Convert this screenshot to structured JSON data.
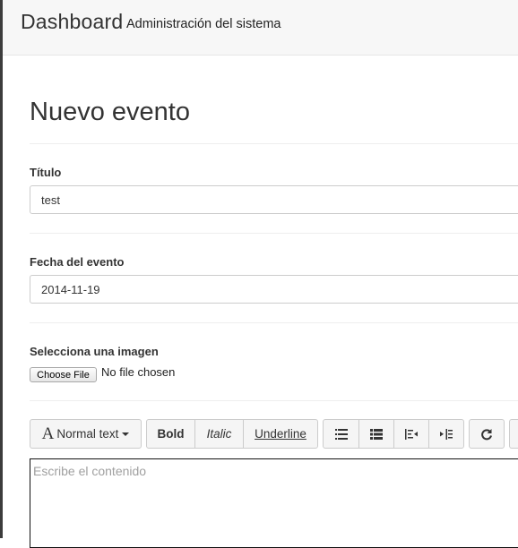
{
  "header": {
    "brand": "Dashboard",
    "subtitle": "Administración del sistema"
  },
  "page": {
    "title": "Nuevo evento"
  },
  "form": {
    "titulo": {
      "label": "Título",
      "value": "test"
    },
    "fecha": {
      "label": "Fecha del evento",
      "value": "2014-11-19"
    },
    "imagen": {
      "label": "Selecciona una imagen",
      "button_label": "Choose File",
      "status": "No file chosen"
    },
    "editor": {
      "placeholder": "Escribe el contenido"
    }
  },
  "toolbar": {
    "style_icon": "A",
    "style_label": "Normal text",
    "bold_label": "Bold",
    "italic_label": "Italic",
    "underline_label": "Underline",
    "icons": [
      "unordered-list-icon",
      "ordered-list-icon",
      "outdent-icon",
      "indent-icon",
      "redo-icon"
    ]
  },
  "colors": {
    "header_bg": "#f7f7f7",
    "left_edge": "#3c3c3c",
    "border": "#cccccc",
    "toolbar_bg": "#f5f5f5",
    "placeholder": "#a0a0a0"
  }
}
